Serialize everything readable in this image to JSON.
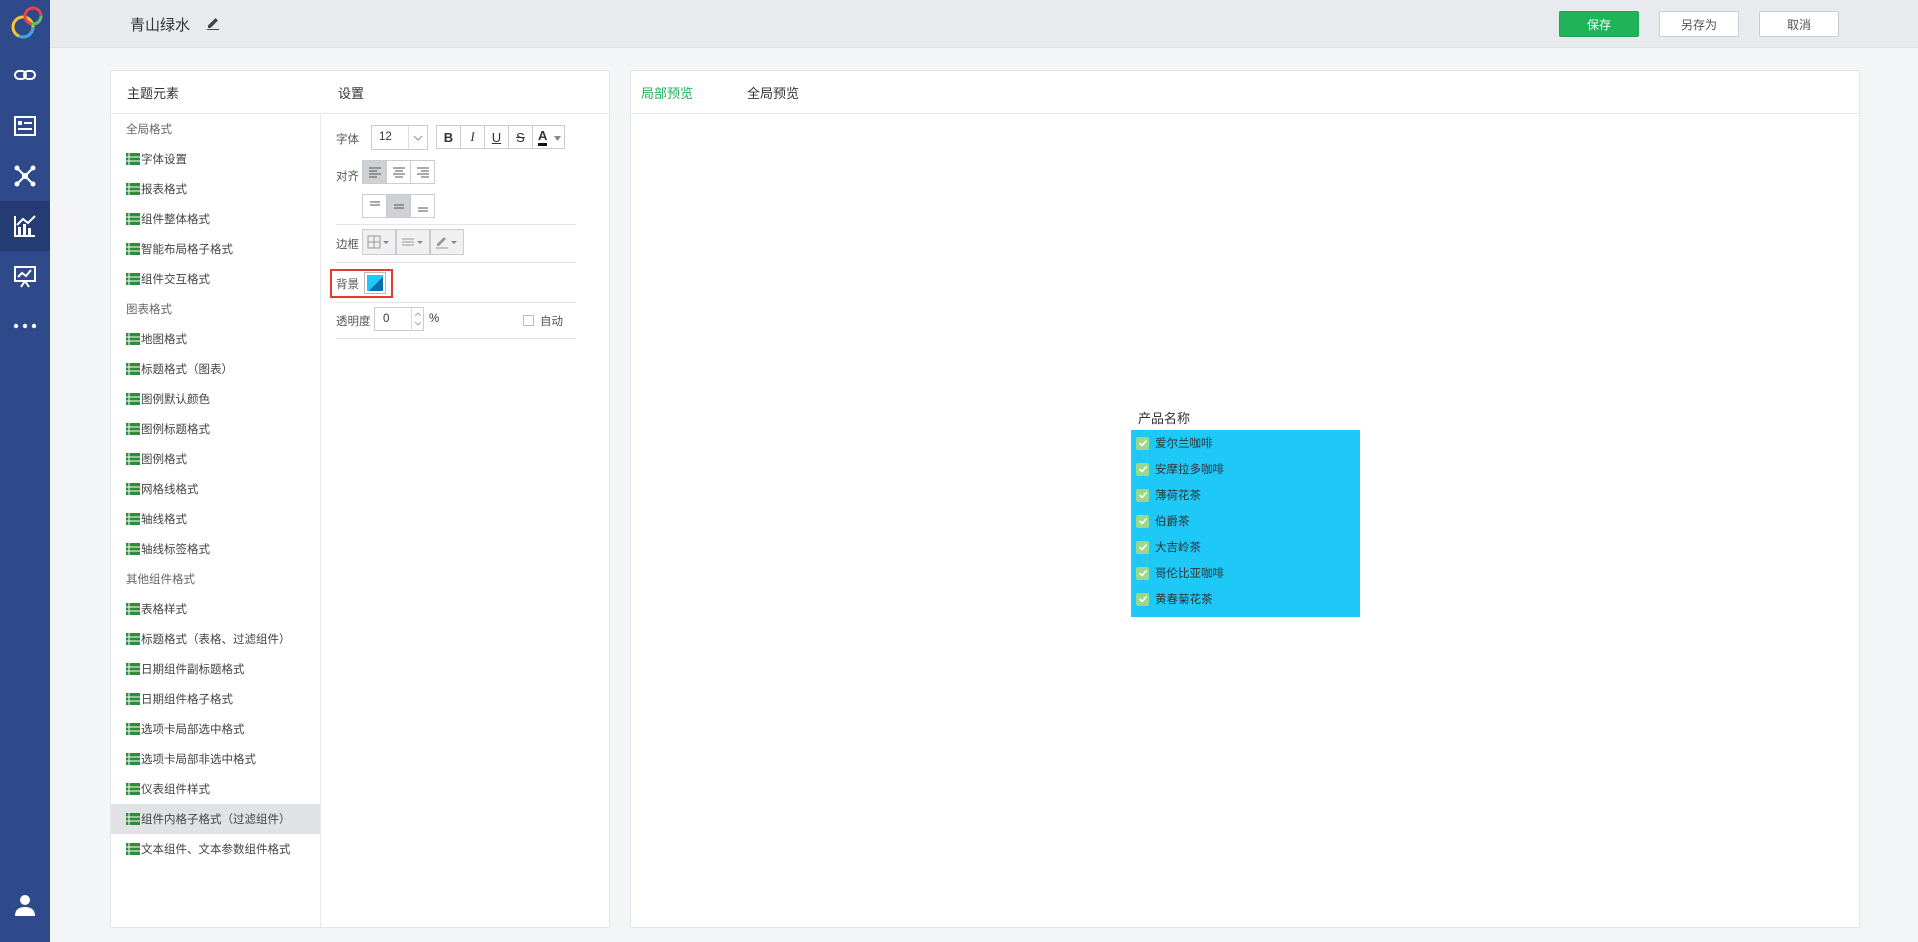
{
  "header": {
    "title": "青山绿水",
    "save_label": "保存",
    "save_as_label": "另存为",
    "cancel_label": "取消"
  },
  "colors": {
    "accent": "#21b35a",
    "rail": "#2f4a8a",
    "preview_bg": "#1ec8f7",
    "highlight": "#e53935"
  },
  "nav_icons": [
    "link-icon",
    "list-card-icon",
    "network-icon",
    "chart-icon",
    "presentation-icon",
    "more-icon",
    "user-icon"
  ],
  "left_panel": {
    "elements_header": "主题元素",
    "settings_header": "设置",
    "tree": [
      {
        "label": "全局格式",
        "group": true
      },
      {
        "label": "字体设置"
      },
      {
        "label": "报表格式"
      },
      {
        "label": "组件整体格式"
      },
      {
        "label": "智能布局格子格式"
      },
      {
        "label": "组件交互格式"
      },
      {
        "label": "图表格式",
        "group": true
      },
      {
        "label": "地图格式"
      },
      {
        "label": "标题格式（图表）"
      },
      {
        "label": "图例默认颜色"
      },
      {
        "label": "图例标题格式"
      },
      {
        "label": "图例格式"
      },
      {
        "label": "网格线格式"
      },
      {
        "label": "轴线格式"
      },
      {
        "label": "轴线标签格式"
      },
      {
        "label": "其他组件格式",
        "group": true
      },
      {
        "label": "表格样式"
      },
      {
        "label": "标题格式（表格、过滤组件）"
      },
      {
        "label": "日期组件副标题格式"
      },
      {
        "label": "日期组件格子格式"
      },
      {
        "label": "选项卡局部选中格式"
      },
      {
        "label": "选项卡局部非选中格式"
      },
      {
        "label": "仪表组件样式"
      },
      {
        "label": "组件内格子格式（过滤组件）",
        "selected": true
      },
      {
        "label": "文本组件、文本参数组件格式"
      }
    ]
  },
  "settings": {
    "font_label": "字体",
    "font_size": "12",
    "bold": "B",
    "italic": "I",
    "underline": "U",
    "strike": "S",
    "font_color": "A",
    "align_label": "对齐",
    "border_label": "边框",
    "background_label": "背景",
    "background_color": "#1ec8f7",
    "opacity_label": "透明度",
    "opacity_value": "0",
    "opacity_unit": "%",
    "auto_label": "自动"
  },
  "preview": {
    "tab_local": "局部预览",
    "tab_global": "全局预览",
    "widget_title": "产品名称",
    "items": [
      "爱尔兰咖啡",
      "安摩拉多咖啡",
      "薄荷花茶",
      "伯爵茶",
      "大吉岭茶",
      "哥伦比亚咖啡",
      "黄春菊花茶"
    ]
  }
}
